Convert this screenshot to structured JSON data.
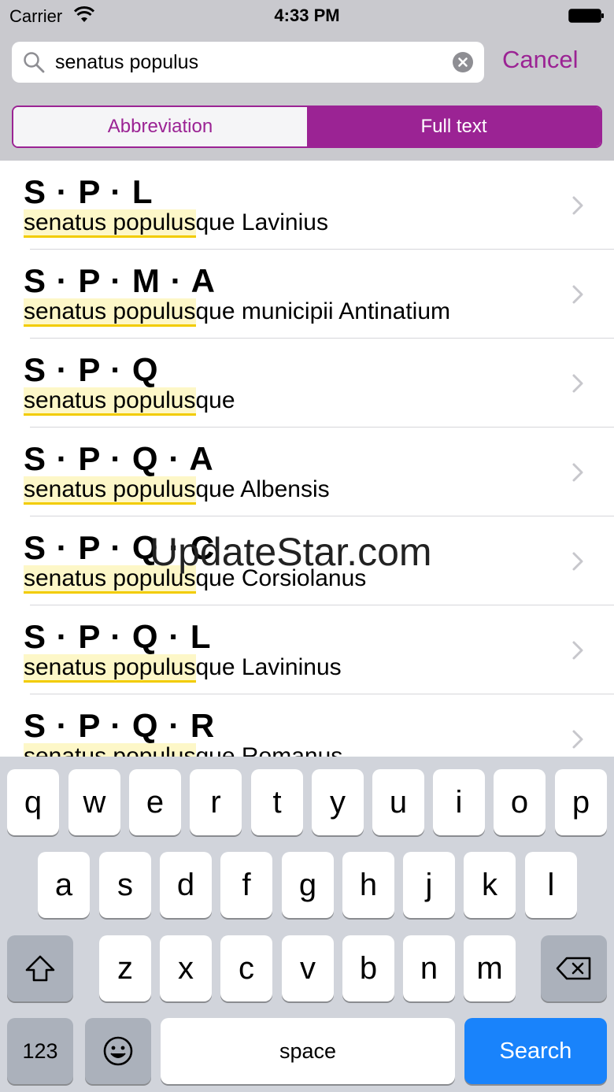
{
  "status_bar": {
    "carrier": "Carrier",
    "time": "4:33 PM",
    "wifi_icon": "wifi-icon",
    "battery_icon": "battery-icon"
  },
  "search": {
    "value": "senatus populus",
    "cancel_label": "Cancel",
    "clear_icon": "clear-icon",
    "search_icon": "magnifier-icon"
  },
  "segments": {
    "abbreviation": "Abbreviation",
    "full_text": "Full text",
    "selected": "Full text"
  },
  "results": [
    {
      "abbr": "S · P · L",
      "match": "senatus populus",
      "rest": "que Lavinius"
    },
    {
      "abbr": "S · P · M · A",
      "match": "senatus populus",
      "rest": "que municipii Antinatium"
    },
    {
      "abbr": "S · P · Q",
      "match": "senatus populus",
      "rest": "que"
    },
    {
      "abbr": "S · P · Q · A",
      "match": "senatus populus",
      "rest": "que Albensis"
    },
    {
      "abbr": "S · P · Q · C",
      "match": "senatus populus",
      "rest": "que Corsiolanus"
    },
    {
      "abbr": "S · P · Q · L",
      "match": "senatus populus",
      "rest": "que Lavininus"
    },
    {
      "abbr": "S · P · Q · R",
      "match": "senatus populus",
      "rest": "que Romanus"
    }
  ],
  "watermark": "UpdateStar.com",
  "keyboard": {
    "row1": [
      "q",
      "w",
      "e",
      "r",
      "t",
      "y",
      "u",
      "i",
      "o",
      "p"
    ],
    "row2": [
      "a",
      "s",
      "d",
      "f",
      "g",
      "h",
      "j",
      "k",
      "l"
    ],
    "row3": [
      "z",
      "x",
      "c",
      "v",
      "b",
      "n",
      "m"
    ],
    "numbers_label": "123",
    "space_label": "space",
    "search_label": "Search",
    "shift_icon": "shift-icon",
    "delete_icon": "delete-icon",
    "emoji_icon": "emoji-icon"
  },
  "colors": {
    "accent": "#9b2394",
    "highlight": "#fdf7c8",
    "search_key": "#1983fb"
  }
}
